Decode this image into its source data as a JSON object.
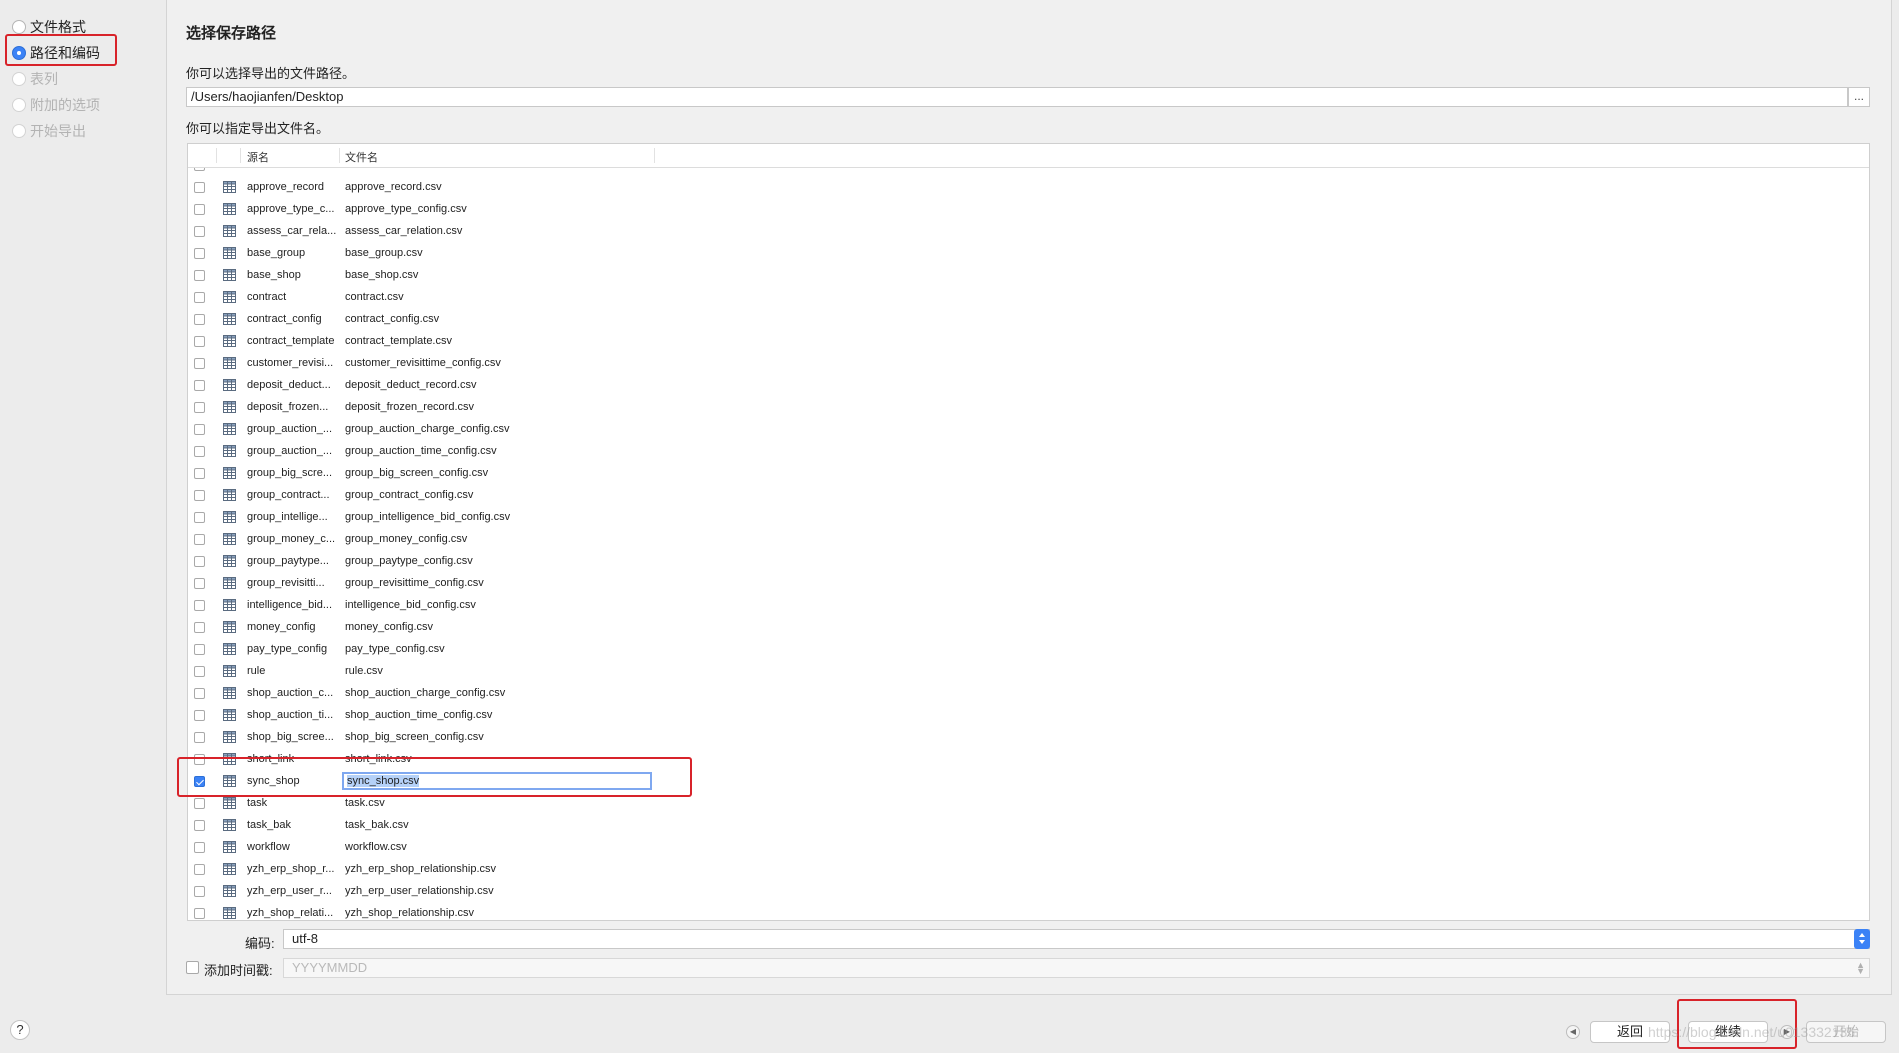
{
  "sidebar": {
    "steps": [
      {
        "label": "文件格式",
        "state": "normal"
      },
      {
        "label": "路径和编码",
        "state": "active"
      },
      {
        "label": "表列",
        "state": "disabled"
      },
      {
        "label": "附加的选项",
        "state": "disabled"
      },
      {
        "label": "开始导出",
        "state": "disabled"
      }
    ]
  },
  "main": {
    "heading": "选择保存路径",
    "path_hint": "你可以选择导出的文件路径。",
    "path_value": "/Users/haojianfen/Desktop",
    "path_button": "...",
    "file_hint": "你可以指定导出文件名。",
    "table": {
      "columns": [
        "源名",
        "文件名"
      ],
      "rows": [
        {
          "source": "approve_record",
          "file": "approve_record.csv",
          "checked": false
        },
        {
          "source": "approve_type_c...",
          "file": "approve_type_config.csv",
          "checked": false
        },
        {
          "source": "assess_car_rela...",
          "file": "assess_car_relation.csv",
          "checked": false
        },
        {
          "source": "base_group",
          "file": "base_group.csv",
          "checked": false
        },
        {
          "source": "base_shop",
          "file": "base_shop.csv",
          "checked": false
        },
        {
          "source": "contract",
          "file": "contract.csv",
          "checked": false
        },
        {
          "source": "contract_config",
          "file": "contract_config.csv",
          "checked": false
        },
        {
          "source": "contract_template",
          "file": "contract_template.csv",
          "checked": false
        },
        {
          "source": "customer_revisi...",
          "file": "customer_revisittime_config.csv",
          "checked": false
        },
        {
          "source": "deposit_deduct...",
          "file": "deposit_deduct_record.csv",
          "checked": false
        },
        {
          "source": "deposit_frozen...",
          "file": "deposit_frozen_record.csv",
          "checked": false
        },
        {
          "source": "group_auction_...",
          "file": "group_auction_charge_config.csv",
          "checked": false
        },
        {
          "source": "group_auction_...",
          "file": "group_auction_time_config.csv",
          "checked": false
        },
        {
          "source": "group_big_scre...",
          "file": "group_big_screen_config.csv",
          "checked": false
        },
        {
          "source": "group_contract...",
          "file": "group_contract_config.csv",
          "checked": false
        },
        {
          "source": "group_intellige...",
          "file": "group_intelligence_bid_config.csv",
          "checked": false
        },
        {
          "source": "group_money_c...",
          "file": "group_money_config.csv",
          "checked": false
        },
        {
          "source": "group_paytype...",
          "file": "group_paytype_config.csv",
          "checked": false
        },
        {
          "source": "group_revisitti...",
          "file": "group_revisittime_config.csv",
          "checked": false
        },
        {
          "source": "intelligence_bid...",
          "file": "intelligence_bid_config.csv",
          "checked": false
        },
        {
          "source": "money_config",
          "file": "money_config.csv",
          "checked": false
        },
        {
          "source": "pay_type_config",
          "file": "pay_type_config.csv",
          "checked": false
        },
        {
          "source": "rule",
          "file": "rule.csv",
          "checked": false
        },
        {
          "source": "shop_auction_c...",
          "file": "shop_auction_charge_config.csv",
          "checked": false
        },
        {
          "source": "shop_auction_ti...",
          "file": "shop_auction_time_config.csv",
          "checked": false
        },
        {
          "source": "shop_big_scree...",
          "file": "shop_big_screen_config.csv",
          "checked": false
        },
        {
          "source": "short_link",
          "file": "short_link.csv",
          "checked": false
        },
        {
          "source": "sync_shop",
          "file": "sync_shop.csv",
          "checked": true,
          "editing": true
        },
        {
          "source": "task",
          "file": "task.csv",
          "checked": false
        },
        {
          "source": "task_bak",
          "file": "task_bak.csv",
          "checked": false
        },
        {
          "source": "workflow",
          "file": "workflow.csv",
          "checked": false
        },
        {
          "source": "yzh_erp_shop_r...",
          "file": "yzh_erp_shop_relationship.csv",
          "checked": false
        },
        {
          "source": "yzh_erp_user_r...",
          "file": "yzh_erp_user_relationship.csv",
          "checked": false
        },
        {
          "source": "yzh_shop_relati...",
          "file": "yzh_shop_relationship.csv",
          "checked": false
        }
      ]
    },
    "encoding_label": "编码:",
    "encoding_value": "utf-8",
    "timestamp_label": "添加时间戳:",
    "timestamp_placeholder": "YYYYMMDD"
  },
  "footer": {
    "help": "?",
    "back_button": "返回",
    "continue_button": "继续",
    "start_button": "开始",
    "watermark": "https://blog.csdn.net/u013332135"
  },
  "colors": {
    "accent": "#3b82f6",
    "highlight": "#d8232a"
  },
  "icons": {
    "table_row": "table-grid-icon"
  }
}
